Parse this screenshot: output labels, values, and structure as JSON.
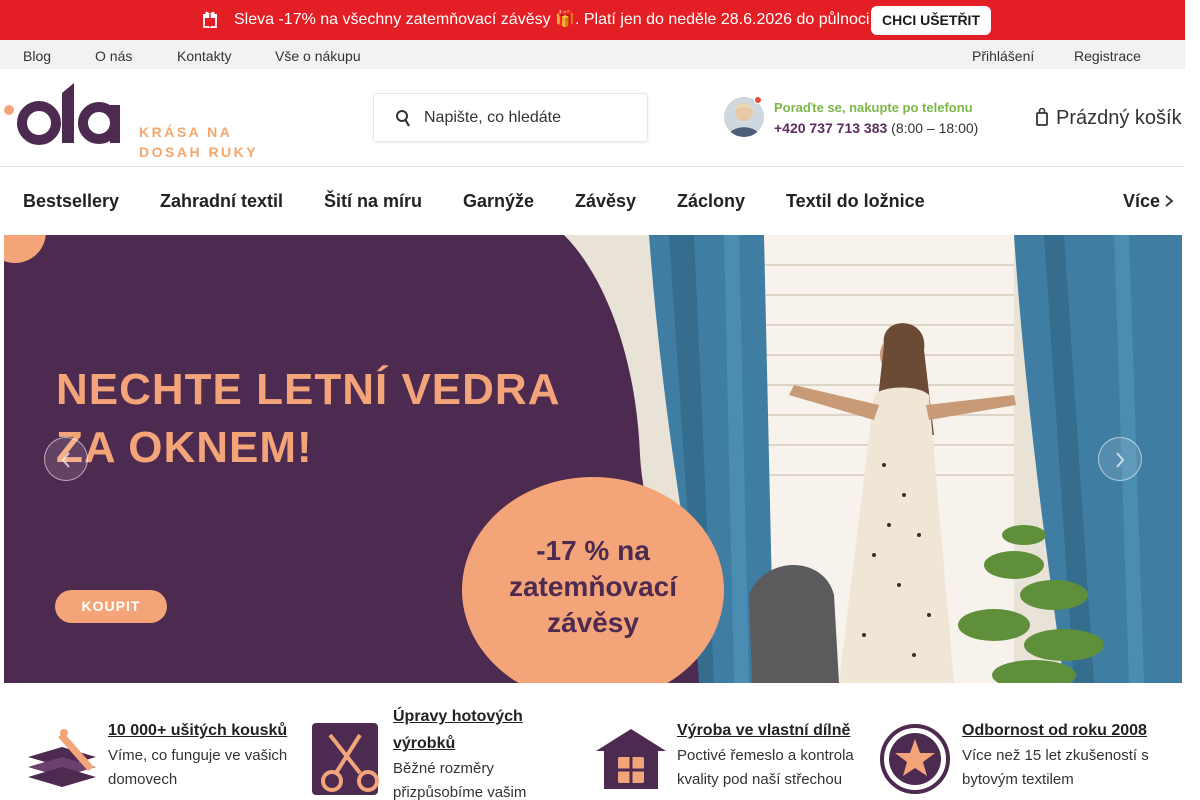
{
  "promo": {
    "text": "Sleva -17% na všechny zatemňovací závěsy 🎁. Platí jen do neděle 28.6.2026 do půlnoci",
    "button": "CHCI UŠETŘIT",
    "icon": "gift-icon",
    "color": "#e31e24"
  },
  "toplinks": {
    "blog": "Blog",
    "about": "O nás",
    "contacts": "Kontakty",
    "shopping": "Vše o nákupu",
    "login": "Přihlášení",
    "register": "Registrace"
  },
  "header": {
    "logo_tagline": "KRÁSA NA DOSAH RUKY",
    "search_placeholder": "Napište, co hledáte",
    "phone_caption": "Poraďte se, nakupte po telefonu",
    "phone_number": "+420 737 713 383",
    "phone_hours": " (8:00 – 18:00)",
    "cart": "Prázdný košík"
  },
  "nav": {
    "items": [
      "Bestsellery",
      "Zahradní textil",
      "Šití na míru",
      "Garnýže",
      "Závěsy",
      "Záclony",
      "Textil do ložnice"
    ],
    "more": "Více"
  },
  "banner": {
    "headline_line1": "NECHTE LETNÍ VEDRA",
    "headline_line2": "ZA OKNEM!",
    "badge_line1": "-17 % na",
    "badge_line2": "zatemňovací",
    "badge_line3": "závěsy",
    "button": "KOUPIT",
    "brand_color": "#4d2a4f",
    "accent_color": "#f4a479"
  },
  "features": [
    {
      "title": "10 000+ ušitých kousků",
      "desc": "Víme, co funguje ve vašich domovech",
      "icon": "fabric-stack-icon"
    },
    {
      "title": "Úpravy hotových výrobků",
      "desc": "Běžné rozměry přizpůsobíme vašim potřebám",
      "icon": "scissors-icon"
    },
    {
      "title": "Výroba ve vlastní dílně",
      "desc": "Poctivé řemeslo a kontrola kvality pod naší střechou",
      "icon": "house-icon"
    },
    {
      "title": "Odbornost od roku 2008",
      "desc": "Více než 15 let zkušeností s bytovým textilem",
      "icon": "star-badge-icon"
    }
  ]
}
